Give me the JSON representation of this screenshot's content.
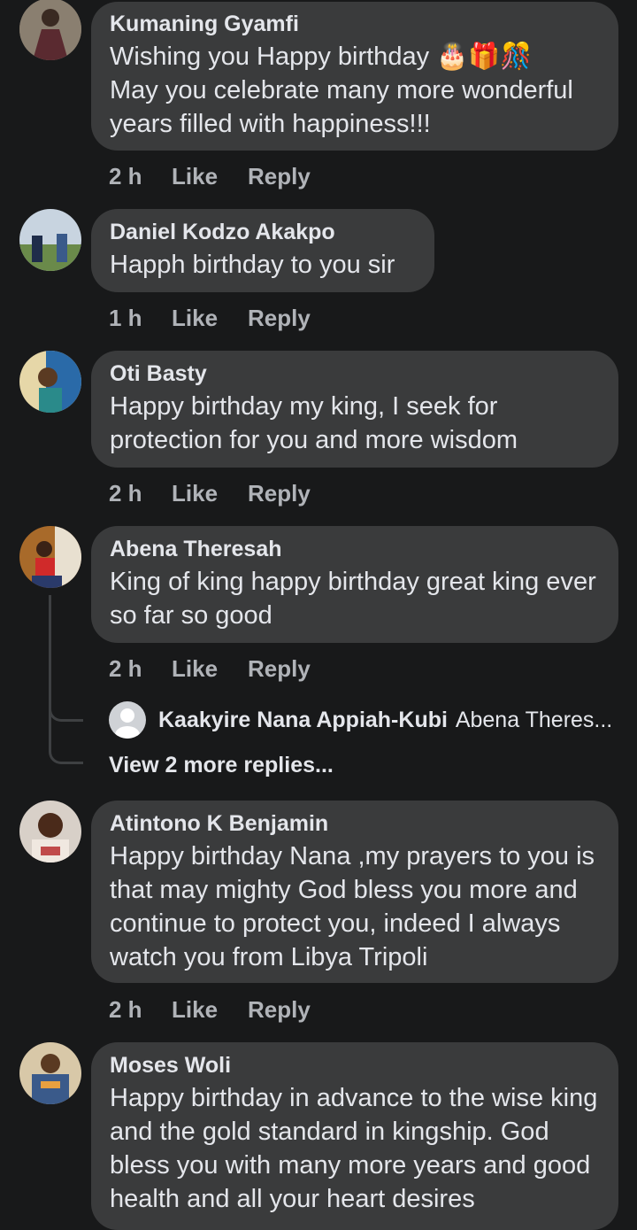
{
  "comments": [
    {
      "author": "Kumaning Gyamfi",
      "text": "Wishing you Happy birthday 🎂🎁🎊\nMay you celebrate many more wonderful years filled with happiness!!!",
      "time": "2 h",
      "like": "Like",
      "reply": "Reply"
    },
    {
      "author": "Daniel Kodzo Akakpo",
      "text": "Happh birthday to you sir",
      "time": "1 h",
      "like": "Like",
      "reply": "Reply"
    },
    {
      "author": "Oti Basty",
      "text": "Happy birthday my king, I seek for protection for you and more wisdom",
      "time": "2 h",
      "like": "Like",
      "reply": "Reply"
    },
    {
      "author": "Abena Theresah",
      "text": "King of king happy birthday great king ever so far so good",
      "time": "2 h",
      "like": "Like",
      "reply": "Reply",
      "reply_preview": {
        "author": "Kaakyire Nana Appiah-Kubi",
        "text": "Abena Theres..."
      },
      "view_more": "View 2 more replies..."
    },
    {
      "author": "Atintono K Benjamin",
      "text": "Happy birthday Nana ,my prayers to you is that may mighty God bless you more and continue to protect you, indeed I always watch you from Libya Tripoli",
      "time": "2 h",
      "like": "Like",
      "reply": "Reply"
    },
    {
      "author": "Moses Woli",
      "text": "Happy birthday in advance to the wise king and the gold standard in kingship. God bless you with many more years and good health and all your heart desires"
    }
  ]
}
